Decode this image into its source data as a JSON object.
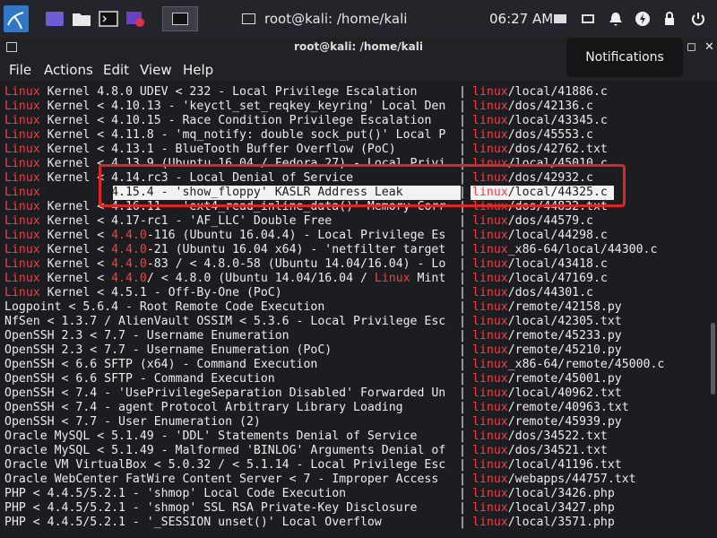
{
  "panel": {
    "window_title": "root@kali: /home/kali",
    "clock": "06:27 AM"
  },
  "window": {
    "title": "root@kali: /home/kali",
    "menu": [
      "File",
      "Actions",
      "Edit",
      "View",
      "Help"
    ]
  },
  "notification": "Notifications",
  "colors": {
    "accent_red": "#ff3b3b",
    "annotation": "#e02323",
    "text": "#ececec"
  },
  "rows": [
    {
      "prefix": "Linux",
      "body": " Kernel 4.8.0 UDEV < 232 - Local Privilege Escalation",
      "rprefix": "linux",
      "path": "/local/41886.c"
    },
    {
      "prefix": "Linux",
      "body": " Kernel < 4.10.13 - 'keyctl_set_reqkey_keyring' Local Den",
      "rprefix": "linux",
      "path": "/dos/42136.c"
    },
    {
      "prefix": "Linux",
      "body": " Kernel < 4.10.15 - Race Condition Privilege Escalation",
      "rprefix": "linux",
      "path": "/local/43345.c"
    },
    {
      "prefix": "Linux",
      "body": " Kernel < 4.11.8 - 'mq_notify: double sock_put()' Local P",
      "rprefix": "linux",
      "path": "/dos/45553.c"
    },
    {
      "prefix": "Linux",
      "body": " Kernel < 4.13.1 - BlueTooth Buffer Overflow (PoC)",
      "rprefix": "linux",
      "path": "/dos/42762.txt"
    },
    {
      "prefix": "Linux",
      "body": " Kernel < 4.13.9 (Ubuntu 16.04 / Fedora 27) - Local Privi",
      "rprefix": "linux",
      "path": "/local/45010.c"
    },
    {
      "prefix": "Linux",
      "body": " Kernel < 4.14.rc3 - Local Denial of Service",
      "rprefix": "linux",
      "path": "/dos/42932.c"
    },
    {
      "prefix": "Linux",
      "body": " Kernel < 4.15.4 - 'show_floppy' KASLR Address Leak",
      "rprefix": "linux",
      "path": "/local/44325.c",
      "selected": true
    },
    {
      "prefix": "Linux",
      "body": " Kernel < 4.16.11 - 'ext4_read_inline_data()' Memory Corr",
      "rprefix": "linux",
      "path": "/dos/44832.txt"
    },
    {
      "prefix": "Linux",
      "body": " Kernel < 4.17-rc1 - 'AF_LLC' Double Free",
      "rprefix": "linux",
      "path": "/dos/44579.c"
    },
    {
      "prefix": "Linux",
      "body": " Kernel < ",
      "mid": "4.4.0",
      "body2": "-116 (Ubuntu 16.04.4) - Local Privilege Es",
      "rprefix": "linux",
      "path": "/local/44298.c"
    },
    {
      "prefix": "Linux",
      "body": " Kernel < ",
      "mid": "4.4.0",
      "body2": "-21 (Ubuntu 16.04 x64) - 'netfilter target",
      "rprefix": "linux",
      "path": "_x86-64/local/44300.c"
    },
    {
      "prefix": "Linux",
      "body": " Kernel < ",
      "mid": "4.4.0",
      "body2": "-83 / < 4.8.0-58 (Ubuntu 14.04/16.04) - Lo",
      "rprefix": "linux",
      "path": "/local/43418.c"
    },
    {
      "prefix": "Linux",
      "body": " Kernel < ",
      "mid": "4.4.0",
      "body2": "/ < 4.8.0 (Ubuntu 14.04/16.04 / ",
      "mid2": "Linux",
      "body3": " Mint",
      "rprefix": "linux",
      "path": "/local/47169.c"
    },
    {
      "prefix": "Linux",
      "body": " Kernel < 4.5.1 - Off-By-One (PoC)",
      "rprefix": "linux",
      "path": "/dos/44301.c"
    },
    {
      "prefix": "",
      "body": "Logpoint < 5.6.4 - Root Remote Code Execution",
      "rprefix": "linux",
      "path": "/remote/42158.py"
    },
    {
      "prefix": "",
      "body": "NfSen < 1.3.7 / AlienVault OSSIM < 5.3.6 - Local Privilege Esc",
      "rprefix": "linux",
      "path": "/local/42305.txt"
    },
    {
      "prefix": "",
      "body": "OpenSSH 2.3 < 7.7 - Username Enumeration",
      "rprefix": "linux",
      "path": "/remote/45233.py"
    },
    {
      "prefix": "",
      "body": "OpenSSH 2.3 < 7.7 - Username Enumeration (PoC)",
      "rprefix": "linux",
      "path": "/remote/45210.py"
    },
    {
      "prefix": "",
      "body": "OpenSSH < 6.6 SFTP (x64) - Command Execution",
      "rprefix": "linux",
      "path": "_x86-64/remote/45000.c"
    },
    {
      "prefix": "",
      "body": "OpenSSH < 6.6 SFTP - Command Execution",
      "rprefix": "linux",
      "path": "/remote/45001.py"
    },
    {
      "prefix": "",
      "body": "OpenSSH < 7.4 - 'UsePrivilegeSeparation Disabled' Forwarded Un",
      "rprefix": "linux",
      "path": "/local/40962.txt"
    },
    {
      "prefix": "",
      "body": "OpenSSH < 7.4 - agent Protocol Arbitrary Library Loading",
      "rprefix": "linux",
      "path": "/remote/40963.txt"
    },
    {
      "prefix": "",
      "body": "OpenSSH < 7.7 - User Enumeration (2)",
      "rprefix": "linux",
      "path": "/remote/45939.py"
    },
    {
      "prefix": "",
      "body": "Oracle MySQL < 5.1.49 - 'DDL' Statements Denial of Service",
      "rprefix": "linux",
      "path": "/dos/34522.txt"
    },
    {
      "prefix": "",
      "body": "Oracle MySQL < 5.1.49 - Malformed 'BINLOG' Arguments Denial of",
      "rprefix": "linux",
      "path": "/dos/34521.txt"
    },
    {
      "prefix": "",
      "body": "Oracle VM VirtualBox < 5.0.32 / < 5.1.14 - Local Privilege Esc",
      "rprefix": "linux",
      "path": "/local/41196.txt"
    },
    {
      "prefix": "",
      "body": "Oracle WebCenter FatWire Content Server < 7 - Improper Access",
      "rprefix": "linux",
      "path": "/webapps/44757.txt"
    },
    {
      "prefix": "",
      "body": "PHP < 4.4.5/5.2.1 - 'shmop' Local Code Execution",
      "rprefix": "linux",
      "path": "/local/3426.php"
    },
    {
      "prefix": "",
      "body": "PHP < 4.4.5/5.2.1 - 'shmop' SSL RSA Private-Key Disclosure",
      "rprefix": "linux",
      "path": "/local/3427.php"
    },
    {
      "prefix": "",
      "body": "PHP < 4.4.5/5.2.1 - '_SESSION unset()' Local Overflow",
      "rprefix": "linux",
      "path": "/local/3571.php"
    }
  ]
}
